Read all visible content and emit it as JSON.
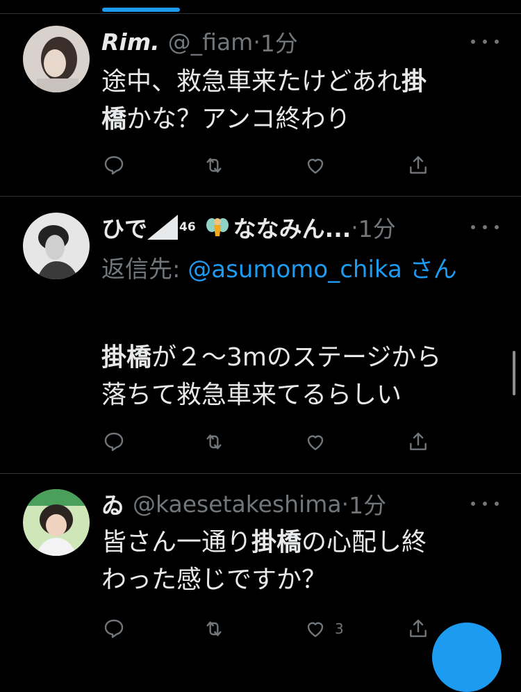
{
  "tweets": [
    {
      "name": "Rim.",
      "handle": "@_fiam",
      "dot": "·",
      "time": "1分",
      "text_line1_pre": "途中、救急車来たけどあれ",
      "text_line1_bold": "掛",
      "text_line2_bold": "橋",
      "text_line2_post": "かな？アンコ終わり"
    },
    {
      "name_pre": "ひで",
      "name_sup": "46",
      "name_post": "ななみん...",
      "dot": "·",
      "time": "1分",
      "reply_label": "返信先: ",
      "reply_handle": "@asumomo_chika",
      "reply_suffix": " さん",
      "text_line1_bold": "掛橋",
      "text_line1_post": "が２～3mのステージから",
      "text_line2": "落ちて救急車来てるらしい"
    },
    {
      "name": "ゐ",
      "handle": "@kaesetakeshima",
      "dot": "·",
      "time": "1分",
      "text_line1_pre": "皆さん一通り",
      "text_line1_bold": "掛橋",
      "text_line1_post": "の心配し終",
      "text_line2": "わった感じですか？",
      "like_count": "3"
    }
  ],
  "icons": [
    "reply-icon",
    "retweet-icon",
    "like-icon",
    "share-icon",
    "more-icon"
  ],
  "colors": {
    "accent": "#1d9bf0",
    "secondary_text": "#71767b",
    "divider": "#2f3336"
  }
}
